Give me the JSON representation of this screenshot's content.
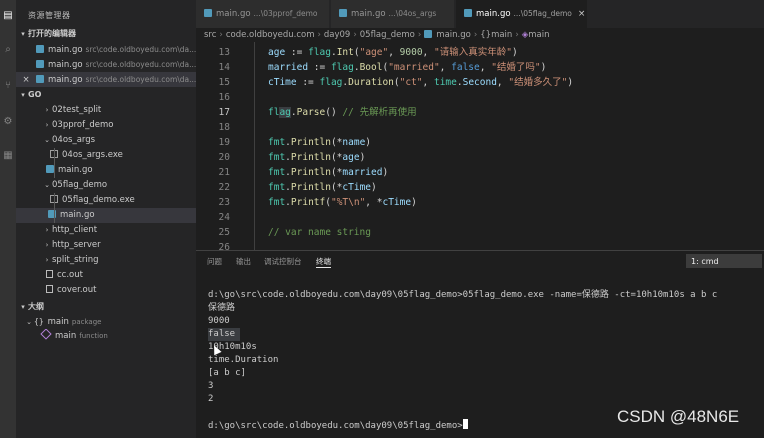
{
  "sidebar": {
    "title": "资源管理器",
    "open_editors": {
      "label": "打开的编辑器",
      "items": [
        {
          "name": "main.go",
          "path": "src\\code.oldboyedu.com\\da..."
        },
        {
          "name": "main.go",
          "path": "src\\code.oldboyedu.com\\da..."
        },
        {
          "name": "main.go",
          "path": "src\\code.oldboyedu.com\\da..."
        }
      ]
    },
    "project": {
      "label": "GO",
      "items": [
        {
          "label": "02test_split"
        },
        {
          "label": "03pprof_demo"
        },
        {
          "label": "04os_args"
        },
        {
          "label": "04os_args.exe"
        },
        {
          "label": "main.go"
        },
        {
          "label": "05flag_demo"
        },
        {
          "label": "05flag_demo.exe"
        },
        {
          "label": "main.go"
        },
        {
          "label": "http_client"
        },
        {
          "label": "http_server"
        },
        {
          "label": "split_string"
        },
        {
          "label": "cc.out"
        },
        {
          "label": "cover.out"
        }
      ]
    },
    "outline": {
      "label": "大纲",
      "items": [
        {
          "label": "main",
          "tag": "package"
        },
        {
          "label": "main",
          "tag": "function"
        }
      ]
    }
  },
  "tabs": [
    {
      "label": "main.go",
      "path": "...\\03pprof_demo"
    },
    {
      "label": "main.go",
      "path": "...\\04os_args"
    },
    {
      "label": "main.go",
      "path": "...\\05flag_demo",
      "close": "×"
    }
  ],
  "breadcrumb": [
    "src",
    "code.oldboyedu.com",
    "day09",
    "05flag_demo",
    "main.go",
    "{}main",
    "main"
  ],
  "editor": {
    "line_numbers": [
      "13",
      "14",
      "15",
      "16",
      "17",
      "18",
      "19",
      "20",
      "21",
      "22",
      "23",
      "24",
      "25",
      "26"
    ],
    "current_line": "17"
  },
  "panel": {
    "tabs": [
      "问题",
      "输出",
      "调试控制台",
      "终端"
    ],
    "active_tab": "终端",
    "terminal_select": "1: cmd",
    "terminal_lines": [
      "d:\\go\\src\\code.oldboyedu.com\\day09\\05flag_demo>05flag_demo.exe -name=保德路 -ct=10h10m10s a b c",
      "保德路",
      "9000",
      "false",
      "10h10m10s",
      "time.Duration",
      "[a b c]",
      "3",
      "2",
      "",
      "d:\\go\\src\\code.oldboyedu.com\\day09\\05flag_demo>"
    ]
  },
  "watermark": "CSDN @48N6E",
  "colors": {
    "keyword": "#569cd6",
    "string": "#ce9178",
    "function": "#dcdcaa",
    "variable": "#9cdcfe",
    "package": "#4ec9b0",
    "comment": "#6a9955"
  }
}
